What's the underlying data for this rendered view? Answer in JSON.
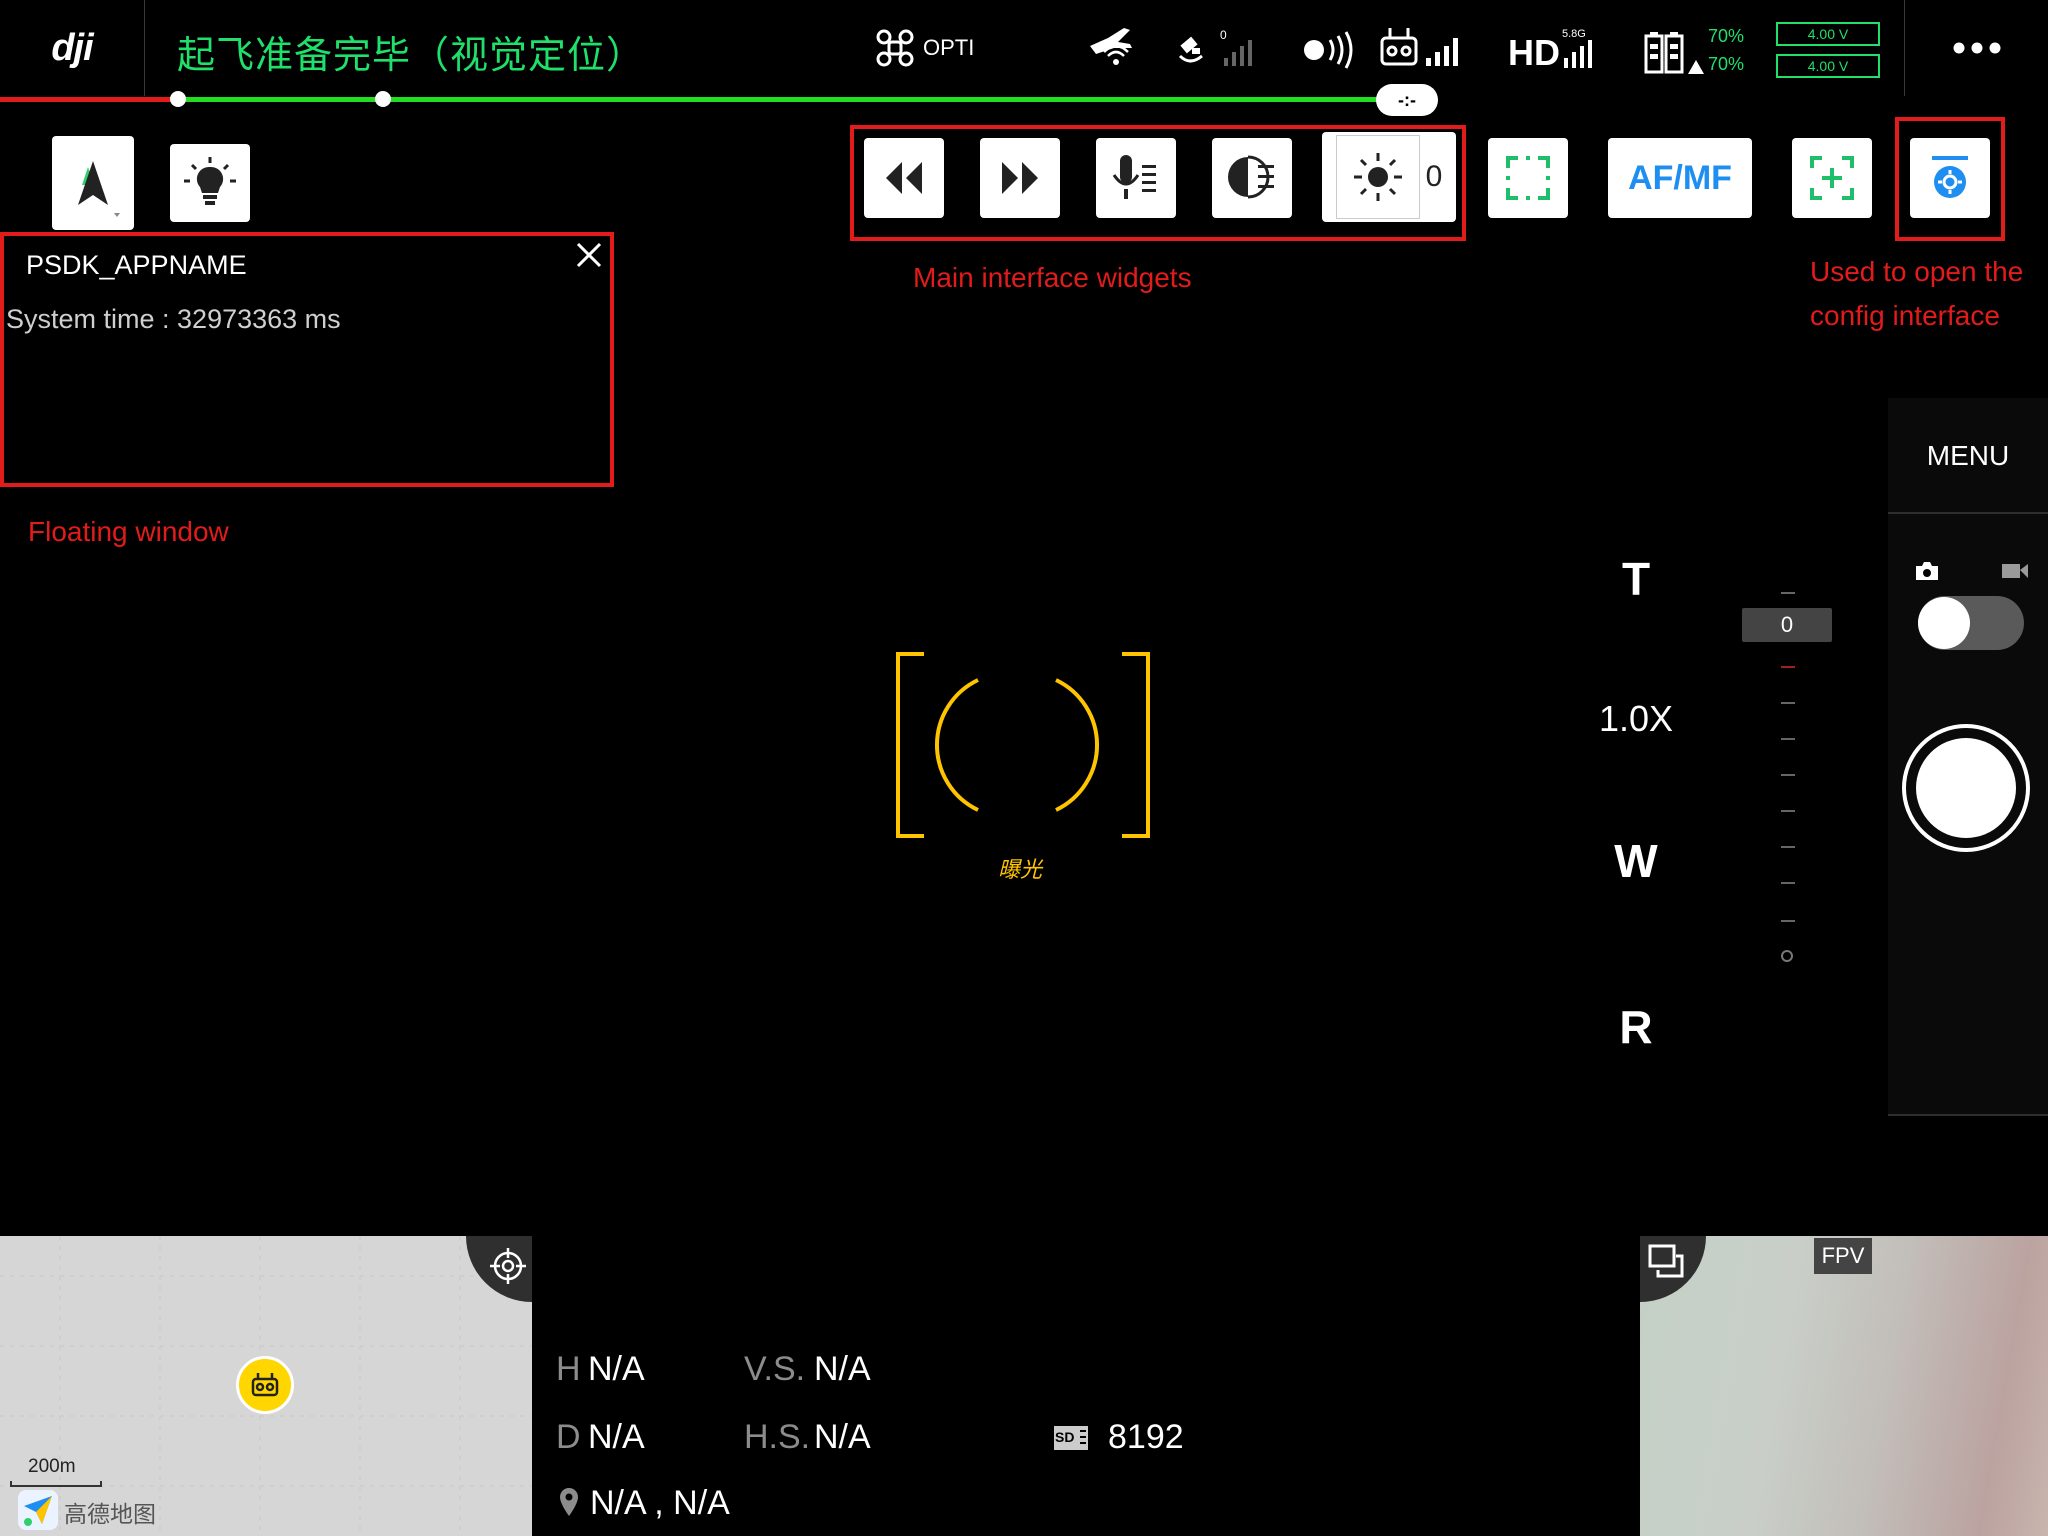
{
  "topbar": {
    "logo": "dji",
    "status": "起飞准备完毕（视觉定位）",
    "obstacle_mode": "OPTI",
    "rc_band_label": "5.8G",
    "hd_label": "HD",
    "gps_count": "0",
    "battery_pct_1": "70%",
    "battery_pct_2": "70%",
    "voltage_1": "4.00 V",
    "voltage_2": "4.00 V",
    "progress_label": "-:-",
    "colors": {
      "status": "#1fe06a",
      "progress_done": "#e21b1b",
      "progress_remaining": "#22dd22"
    }
  },
  "annotations": {
    "floating_window": "Floating window",
    "main_widgets": "Main interface widgets",
    "config_line1": "Used to open the",
    "config_line2": "config interface",
    "color": "#e21b1b"
  },
  "floating_window": {
    "title": "PSDK_APPNAME",
    "system_time": "System time : 32973363 ms"
  },
  "widgets": {
    "icons": [
      "rewind-icon",
      "fast-forward-icon",
      "microphone-icon",
      "half-circle-icon",
      "brightness-icon"
    ],
    "brightness_value": "0"
  },
  "camera_toolbar": {
    "focus_frame": "focus-frame-icon",
    "af_mf": "AF/MF",
    "add_focus": "add-focus-icon",
    "config": "config-gear-icon"
  },
  "camera_panel": {
    "menu": "MENU",
    "mode": "photo",
    "zoom_t": "T",
    "zoom_value": "1.0X",
    "zoom_w": "W",
    "zoom_r": "R",
    "ev_value": "0"
  },
  "center": {
    "exposure_label": "曝光",
    "focus_color": "#ffc400"
  },
  "telemetry": {
    "h_label": "H",
    "h_value": "N/A",
    "vs_label": "V.S.",
    "vs_value": "N/A",
    "d_label": "D",
    "d_value": "N/A",
    "hs_label": "H.S.",
    "hs_value": "N/A",
    "location_value": "N/A , N/A",
    "sd_label": "SD",
    "sd_value": "8192"
  },
  "map": {
    "scale": "200m",
    "provider": "高德地图"
  },
  "fpv": {
    "label": "FPV"
  }
}
